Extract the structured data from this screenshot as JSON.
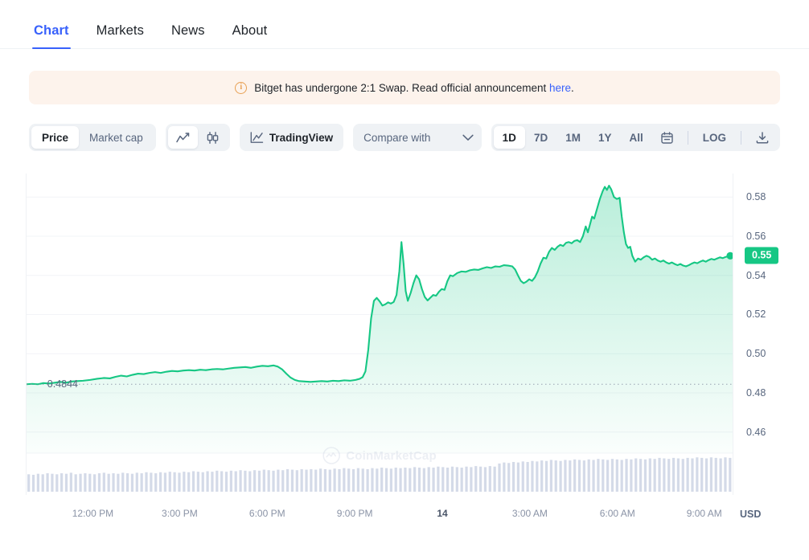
{
  "tabs": [
    {
      "label": "Chart",
      "active": true
    },
    {
      "label": "Markets",
      "active": false
    },
    {
      "label": "News",
      "active": false
    },
    {
      "label": "About",
      "active": false
    }
  ],
  "banner": {
    "icon": "info-circle-icon",
    "text_before": "Bitget has undergone 2:1 Swap. Read official announcement ",
    "link_text": "here",
    "text_after": "."
  },
  "toolbar": {
    "metric_options": [
      {
        "label": "Price",
        "selected": true
      },
      {
        "label": "Market cap",
        "selected": false
      }
    ],
    "chart_type_options": [
      {
        "icon": "line-chart-icon",
        "selected": true
      },
      {
        "icon": "candlestick-chart-icon",
        "selected": false
      }
    ],
    "tradingview": {
      "icon": "tradingview-icon",
      "label": "TradingView"
    },
    "compare": {
      "label": "Compare with",
      "icon": "chevron-down-icon"
    },
    "ranges": [
      {
        "label": "1D",
        "selected": true
      },
      {
        "label": "7D",
        "selected": false
      },
      {
        "label": "1M",
        "selected": false
      },
      {
        "label": "1Y",
        "selected": false
      },
      {
        "label": "All",
        "selected": false
      }
    ],
    "calendar_icon": "calendar-icon",
    "log_label": "LOG",
    "download_icon": "download-icon"
  },
  "chart_data": {
    "type": "area",
    "title": "",
    "xlabel": "",
    "ylabel": "USD",
    "currency": "USD",
    "line_color": "#16c784",
    "fill_color_top": "#16c784",
    "grid": true,
    "legend": "none",
    "ylim": [
      0.4525,
      0.592
    ],
    "yticks": [
      0.58,
      0.56,
      0.54,
      0.52,
      0.5,
      0.48,
      0.46
    ],
    "ytick_labels": [
      "0.58",
      "0.56",
      "0.54",
      "0.52",
      "0.50",
      "0.48",
      "0.46"
    ],
    "current_price": 0.55,
    "current_price_label": "0.55",
    "baseline_value": 0.4844,
    "baseline_label": "0.4844",
    "xtick_labels": [
      {
        "label": "12:00 PM",
        "pos": 0.095,
        "bold": false
      },
      {
        "label": "3:00 PM",
        "pos": 0.218,
        "bold": false
      },
      {
        "label": "6:00 PM",
        "pos": 0.342,
        "bold": false
      },
      {
        "label": "9:00 PM",
        "pos": 0.466,
        "bold": false
      },
      {
        "label": "14",
        "pos": 0.59,
        "bold": true
      },
      {
        "label": "3:00 AM",
        "pos": 0.714,
        "bold": false
      },
      {
        "label": "6:00 AM",
        "pos": 0.838,
        "bold": false
      },
      {
        "label": "9:00 AM",
        "pos": 0.961,
        "bold": false
      }
    ],
    "watermark": "CoinMarketCap",
    "price_series": [
      [
        0.0,
        0.4844
      ],
      [
        0.008,
        0.4846
      ],
      [
        0.016,
        0.4844
      ],
      [
        0.024,
        0.485
      ],
      [
        0.032,
        0.4848
      ],
      [
        0.04,
        0.4852
      ],
      [
        0.048,
        0.4856
      ],
      [
        0.056,
        0.4852
      ],
      [
        0.064,
        0.4858
      ],
      [
        0.072,
        0.486
      ],
      [
        0.08,
        0.4862
      ],
      [
        0.09,
        0.4866
      ],
      [
        0.1,
        0.4872
      ],
      [
        0.11,
        0.4876
      ],
      [
        0.118,
        0.4874
      ],
      [
        0.126,
        0.4882
      ],
      [
        0.134,
        0.4888
      ],
      [
        0.142,
        0.4884
      ],
      [
        0.15,
        0.4892
      ],
      [
        0.158,
        0.4898
      ],
      [
        0.166,
        0.4896
      ],
      [
        0.174,
        0.4902
      ],
      [
        0.182,
        0.4906
      ],
      [
        0.19,
        0.4902
      ],
      [
        0.198,
        0.4908
      ],
      [
        0.206,
        0.4912
      ],
      [
        0.214,
        0.491
      ],
      [
        0.222,
        0.4914
      ],
      [
        0.23,
        0.4916
      ],
      [
        0.238,
        0.4914
      ],
      [
        0.246,
        0.4918
      ],
      [
        0.254,
        0.4916
      ],
      [
        0.262,
        0.492
      ],
      [
        0.27,
        0.4922
      ],
      [
        0.278,
        0.492
      ],
      [
        0.286,
        0.4924
      ],
      [
        0.294,
        0.4928
      ],
      [
        0.302,
        0.493
      ],
      [
        0.31,
        0.4932
      ],
      [
        0.318,
        0.4928
      ],
      [
        0.326,
        0.4934
      ],
      [
        0.334,
        0.4938
      ],
      [
        0.342,
        0.4936
      ],
      [
        0.35,
        0.494
      ],
      [
        0.356,
        0.4934
      ],
      [
        0.362,
        0.492
      ],
      [
        0.368,
        0.4898
      ],
      [
        0.374,
        0.4878
      ],
      [
        0.38,
        0.4866
      ],
      [
        0.386,
        0.486
      ],
      [
        0.394,
        0.4858
      ],
      [
        0.402,
        0.4856
      ],
      [
        0.41,
        0.4858
      ],
      [
        0.418,
        0.486
      ],
      [
        0.426,
        0.4858
      ],
      [
        0.434,
        0.4862
      ],
      [
        0.442,
        0.486
      ],
      [
        0.45,
        0.4864
      ],
      [
        0.458,
        0.4862
      ],
      [
        0.466,
        0.4866
      ],
      [
        0.472,
        0.4872
      ],
      [
        0.476,
        0.488
      ],
      [
        0.48,
        0.491
      ],
      [
        0.484,
        0.502
      ],
      [
        0.488,
        0.518
      ],
      [
        0.492,
        0.527
      ],
      [
        0.496,
        0.5285
      ],
      [
        0.5,
        0.5268
      ],
      [
        0.504,
        0.5246
      ],
      [
        0.508,
        0.5252
      ],
      [
        0.512,
        0.5262
      ],
      [
        0.516,
        0.5256
      ],
      [
        0.52,
        0.5264
      ],
      [
        0.524,
        0.53
      ],
      [
        0.528,
        0.542
      ],
      [
        0.531,
        0.557
      ],
      [
        0.534,
        0.546
      ],
      [
        0.537,
        0.532
      ],
      [
        0.54,
        0.527
      ],
      [
        0.544,
        0.531
      ],
      [
        0.548,
        0.536
      ],
      [
        0.552,
        0.54
      ],
      [
        0.556,
        0.538
      ],
      [
        0.56,
        0.533
      ],
      [
        0.564,
        0.529
      ],
      [
        0.568,
        0.5272
      ],
      [
        0.572,
        0.5286
      ],
      [
        0.576,
        0.53
      ],
      [
        0.58,
        0.5296
      ],
      [
        0.584,
        0.5316
      ],
      [
        0.588,
        0.533
      ],
      [
        0.592,
        0.5326
      ],
      [
        0.596,
        0.537
      ],
      [
        0.6,
        0.54
      ],
      [
        0.604,
        0.5396
      ],
      [
        0.61,
        0.5412
      ],
      [
        0.616,
        0.542
      ],
      [
        0.622,
        0.5418
      ],
      [
        0.628,
        0.5426
      ],
      [
        0.634,
        0.543
      ],
      [
        0.64,
        0.5428
      ],
      [
        0.646,
        0.5436
      ],
      [
        0.652,
        0.5442
      ],
      [
        0.658,
        0.5438
      ],
      [
        0.664,
        0.5446
      ],
      [
        0.67,
        0.5444
      ],
      [
        0.676,
        0.5452
      ],
      [
        0.682,
        0.545
      ],
      [
        0.688,
        0.5446
      ],
      [
        0.692,
        0.543
      ],
      [
        0.696,
        0.54
      ],
      [
        0.7,
        0.5372
      ],
      [
        0.704,
        0.536
      ],
      [
        0.708,
        0.5368
      ],
      [
        0.712,
        0.538
      ],
      [
        0.716,
        0.5372
      ],
      [
        0.72,
        0.539
      ],
      [
        0.724,
        0.542
      ],
      [
        0.728,
        0.546
      ],
      [
        0.732,
        0.549
      ],
      [
        0.736,
        0.5486
      ],
      [
        0.74,
        0.552
      ],
      [
        0.744,
        0.554
      ],
      [
        0.748,
        0.553
      ],
      [
        0.752,
        0.5546
      ],
      [
        0.756,
        0.5556
      ],
      [
        0.76,
        0.555
      ],
      [
        0.764,
        0.5566
      ],
      [
        0.768,
        0.557
      ],
      [
        0.772,
        0.5564
      ],
      [
        0.776,
        0.5576
      ],
      [
        0.78,
        0.558
      ],
      [
        0.784,
        0.557
      ],
      [
        0.788,
        0.56
      ],
      [
        0.792,
        0.565
      ],
      [
        0.795,
        0.562
      ],
      [
        0.798,
        0.566
      ],
      [
        0.801,
        0.57
      ],
      [
        0.804,
        0.569
      ],
      [
        0.808,
        0.574
      ],
      [
        0.812,
        0.579
      ],
      [
        0.816,
        0.583
      ],
      [
        0.819,
        0.5852
      ],
      [
        0.822,
        0.5836
      ],
      [
        0.825,
        0.5858
      ],
      [
        0.828,
        0.584
      ],
      [
        0.832,
        0.58
      ],
      [
        0.836,
        0.579
      ],
      [
        0.84,
        0.5796
      ],
      [
        0.843,
        0.57
      ],
      [
        0.846,
        0.562
      ],
      [
        0.849,
        0.556
      ],
      [
        0.852,
        0.554
      ],
      [
        0.855,
        0.5546
      ],
      [
        0.858,
        0.55
      ],
      [
        0.862,
        0.547
      ],
      [
        0.866,
        0.5486
      ],
      [
        0.87,
        0.548
      ],
      [
        0.874,
        0.5492
      ],
      [
        0.878,
        0.55
      ],
      [
        0.882,
        0.5494
      ],
      [
        0.886,
        0.548
      ],
      [
        0.89,
        0.5486
      ],
      [
        0.894,
        0.5476
      ],
      [
        0.898,
        0.547
      ],
      [
        0.902,
        0.5476
      ],
      [
        0.906,
        0.5466
      ],
      [
        0.91,
        0.546
      ],
      [
        0.914,
        0.5466
      ],
      [
        0.918,
        0.5458
      ],
      [
        0.922,
        0.5452
      ],
      [
        0.926,
        0.5458
      ],
      [
        0.93,
        0.545
      ],
      [
        0.934,
        0.5446
      ],
      [
        0.938,
        0.5452
      ],
      [
        0.942,
        0.546
      ],
      [
        0.946,
        0.5466
      ],
      [
        0.95,
        0.5462
      ],
      [
        0.954,
        0.547
      ],
      [
        0.958,
        0.5476
      ],
      [
        0.962,
        0.547
      ],
      [
        0.966,
        0.5478
      ],
      [
        0.97,
        0.5484
      ],
      [
        0.974,
        0.548
      ],
      [
        0.978,
        0.5486
      ],
      [
        0.982,
        0.5492
      ],
      [
        0.986,
        0.5488
      ],
      [
        0.99,
        0.5494
      ],
      [
        0.994,
        0.5498
      ],
      [
        1.0,
        0.55
      ]
    ],
    "volume_series": [
      0.34,
      0.33,
      0.35,
      0.34,
      0.36,
      0.35,
      0.34,
      0.36,
      0.35,
      0.37,
      0.34,
      0.35,
      0.36,
      0.35,
      0.34,
      0.36,
      0.37,
      0.35,
      0.36,
      0.35,
      0.37,
      0.36,
      0.35,
      0.37,
      0.36,
      0.38,
      0.37,
      0.36,
      0.38,
      0.37,
      0.39,
      0.38,
      0.37,
      0.39,
      0.38,
      0.4,
      0.39,
      0.38,
      0.4,
      0.39,
      0.41,
      0.4,
      0.39,
      0.41,
      0.4,
      0.42,
      0.41,
      0.4,
      0.42,
      0.41,
      0.43,
      0.42,
      0.41,
      0.43,
      0.42,
      0.44,
      0.43,
      0.42,
      0.44,
      0.43,
      0.44,
      0.43,
      0.45,
      0.44,
      0.43,
      0.45,
      0.44,
      0.46,
      0.45,
      0.44,
      0.46,
      0.45,
      0.44,
      0.46,
      0.45,
      0.47,
      0.46,
      0.45,
      0.47,
      0.46,
      0.47,
      0.46,
      0.48,
      0.47,
      0.46,
      0.48,
      0.47,
      0.49,
      0.48,
      0.47,
      0.49,
      0.48,
      0.47,
      0.49,
      0.48,
      0.5,
      0.49,
      0.48,
      0.5,
      0.49,
      0.55,
      0.57,
      0.56,
      0.58,
      0.57,
      0.59,
      0.58,
      0.6,
      0.59,
      0.61,
      0.6,
      0.62,
      0.61,
      0.6,
      0.62,
      0.61,
      0.63,
      0.62,
      0.61,
      0.63,
      0.62,
      0.64,
      0.63,
      0.62,
      0.64,
      0.63,
      0.62,
      0.64,
      0.63,
      0.65,
      0.64,
      0.63,
      0.65,
      0.64,
      0.66,
      0.65,
      0.64,
      0.66,
      0.65,
      0.64,
      0.66,
      0.65,
      0.67,
      0.66,
      0.65,
      0.67,
      0.66,
      0.65,
      0.67,
      0.66
    ]
  }
}
